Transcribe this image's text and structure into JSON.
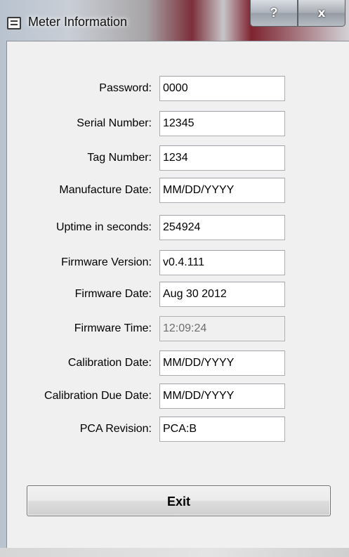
{
  "window": {
    "title": "Meter Information",
    "help_label": "?",
    "close_label": "x",
    "app_icon": "window-menu-icon"
  },
  "form": {
    "fields": [
      {
        "label": "Password:",
        "value": "0000"
      },
      {
        "label": "Serial Number:",
        "value": "12345"
      },
      {
        "label": "Tag Number:",
        "value": "1234"
      },
      {
        "label": "Manufacture Date:",
        "value": "MM/DD/YYYY"
      },
      {
        "label": "Uptime in seconds:",
        "value": "254924"
      },
      {
        "label": "Firmware Version:",
        "value": "v0.4.111"
      },
      {
        "label": "Firmware Date:",
        "value": "Aug 30 2012"
      },
      {
        "label": "Firmware Time:",
        "value": "12:09:24",
        "disabled": true
      },
      {
        "label": "Calibration Date:",
        "value": "MM/DD/YYYY"
      },
      {
        "label": "Calibration Due Date:",
        "value": "MM/DD/YYYY"
      },
      {
        "label": "PCA Revision:",
        "value": "PCA:B"
      }
    ]
  },
  "actions": {
    "exit_label": "Exit"
  }
}
